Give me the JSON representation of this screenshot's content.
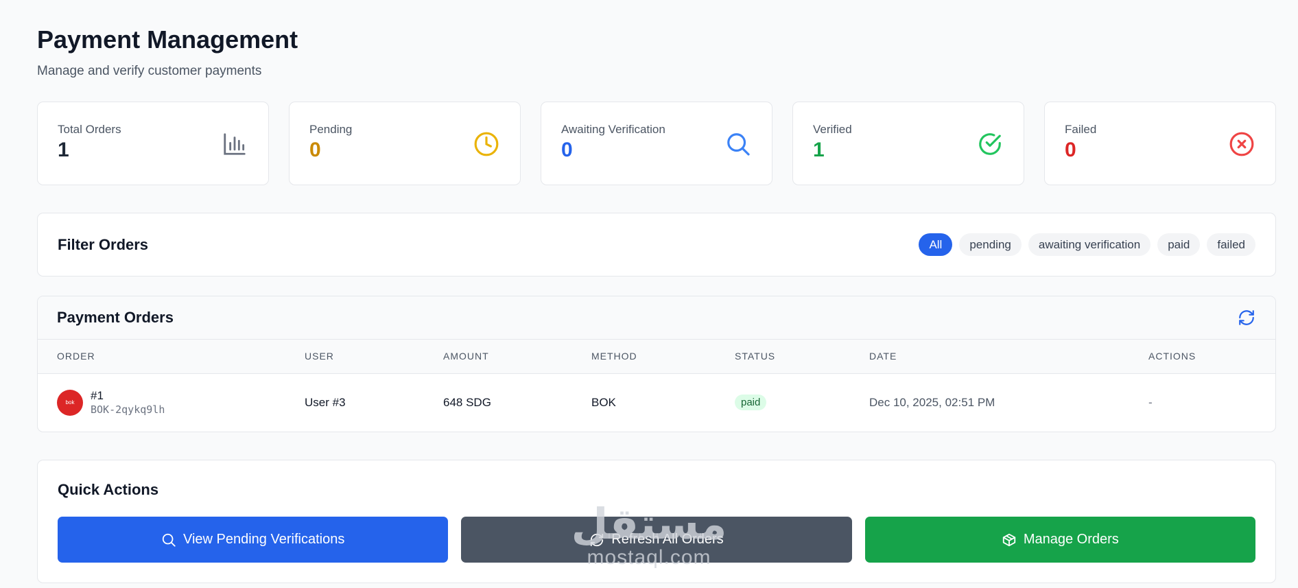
{
  "page": {
    "title": "Payment Management",
    "subtitle": "Manage and verify customer payments"
  },
  "stats": [
    {
      "label": "Total Orders",
      "value": "1",
      "color": "#1f2937",
      "icon": "bar-chart-icon"
    },
    {
      "label": "Pending",
      "value": "0",
      "color": "#ca8a04",
      "icon": "clock-icon"
    },
    {
      "label": "Awaiting Verification",
      "value": "0",
      "color": "#2563eb",
      "icon": "search-icon"
    },
    {
      "label": "Verified",
      "value": "1",
      "color": "#16a34a",
      "icon": "check-circle-icon"
    },
    {
      "label": "Failed",
      "value": "0",
      "color": "#dc2626",
      "icon": "x-circle-icon"
    }
  ],
  "filter": {
    "title": "Filter Orders",
    "chips": [
      "All",
      "pending",
      "awaiting verification",
      "paid",
      "failed"
    ],
    "active": "All"
  },
  "orders": {
    "title": "Payment Orders",
    "columns": [
      "ORDER",
      "USER",
      "AMOUNT",
      "METHOD",
      "STATUS",
      "DATE",
      "ACTIONS"
    ],
    "rows": [
      {
        "order_number": "#1",
        "order_ref": "BOK-2qykq9lh",
        "logo_text": "bok",
        "user": "User #3",
        "amount": "648 SDG",
        "method": "BOK",
        "status": "paid",
        "date": "Dec 10, 2025, 02:51 PM",
        "actions": "-"
      }
    ]
  },
  "quick_actions": {
    "title": "Quick Actions",
    "buttons": [
      {
        "label": "View Pending Verifications",
        "icon": "search-icon",
        "color": "#2563eb"
      },
      {
        "label": "Refresh All Orders",
        "icon": "refresh-icon",
        "color": "#4b5563"
      },
      {
        "label": "Manage Orders",
        "icon": "box-icon",
        "color": "#16a34a"
      }
    ]
  },
  "watermark": {
    "arabic": "مستقل",
    "latin": "mostaql.com"
  }
}
